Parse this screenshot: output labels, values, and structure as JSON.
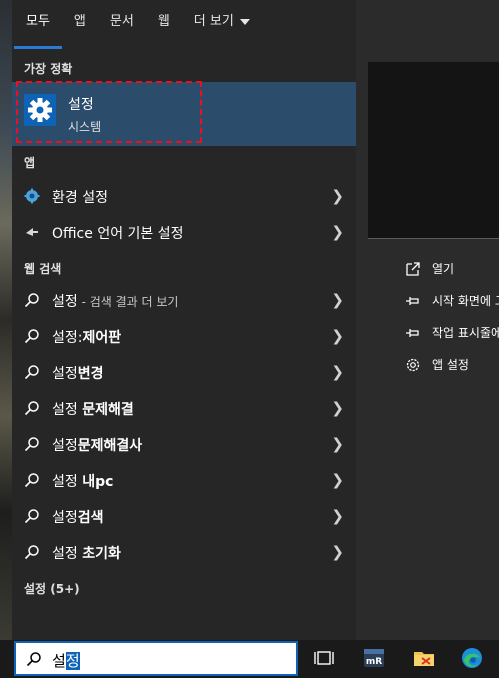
{
  "tabs": [
    {
      "label": "모두"
    },
    {
      "label": "앱"
    },
    {
      "label": "문서"
    },
    {
      "label": "웹"
    },
    {
      "label": "더 보기"
    }
  ],
  "best_match": {
    "section": "가장 정확",
    "title": "설정",
    "subtitle": "시스템"
  },
  "apps": {
    "section": "앱",
    "items": [
      {
        "label": "환경 설정"
      },
      {
        "label": "Office 언어 기본 설정"
      }
    ]
  },
  "web": {
    "section": "웹 검색",
    "items": [
      {
        "label": "설정",
        "hint": " - 검색 결과 더 보기"
      },
      {
        "label": "설정:",
        "bold": "제어판"
      },
      {
        "label": "설정",
        "bold": "변경"
      },
      {
        "label": "설정 ",
        "bold": "문제해결"
      },
      {
        "label": "설정",
        "bold": "문제해결사"
      },
      {
        "label": "설정 ",
        "bold": "내pc"
      },
      {
        "label": "설정",
        "bold": "검색"
      },
      {
        "label": "설정 ",
        "bold": "초기화"
      }
    ]
  },
  "settings_section": "설정 (5+)",
  "actions": [
    {
      "label": "열기",
      "icon": "open-icon"
    },
    {
      "label": "시작 화면에 고",
      "icon": "pin-icon"
    },
    {
      "label": "작업 표시줄에",
      "icon": "pin-icon"
    },
    {
      "label": "앱 설정",
      "icon": "gear-icon"
    }
  ],
  "search": {
    "query_plain": "설",
    "query_selected": "정"
  },
  "colors": {
    "accent": "#0f63b6",
    "highlight": "#2c4c6b",
    "focus": "#e81123"
  }
}
